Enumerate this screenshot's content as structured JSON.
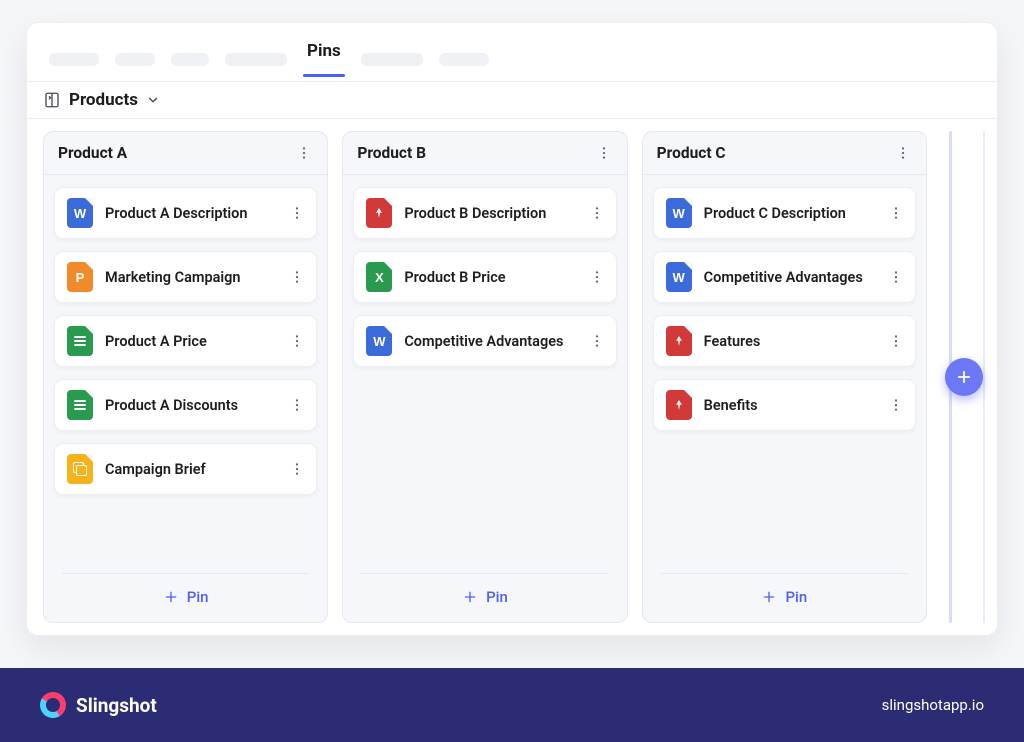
{
  "active_tab": "Pins",
  "section": {
    "title": "Products"
  },
  "columns": [
    {
      "title": "Product A",
      "pins": [
        {
          "label": "Product A Description",
          "type": "word"
        },
        {
          "label": "Marketing Campaign",
          "type": "ppt"
        },
        {
          "label": "Product A Price",
          "type": "sheet"
        },
        {
          "label": "Product A Discounts",
          "type": "sheet"
        },
        {
          "label": "Campaign Brief",
          "type": "doc"
        }
      ]
    },
    {
      "title": "Product B",
      "pins": [
        {
          "label": "Product B Description",
          "type": "pdf"
        },
        {
          "label": "Product B Price",
          "type": "excel"
        },
        {
          "label": "Competitive Advantages",
          "type": "word"
        }
      ]
    },
    {
      "title": "Product C",
      "pins": [
        {
          "label": "Product C Description",
          "type": "word"
        },
        {
          "label": "Competitive Advantages",
          "type": "word"
        },
        {
          "label": "Features",
          "type": "pdf"
        },
        {
          "label": "Benefits",
          "type": "pdf"
        }
      ]
    }
  ],
  "add_pin_label": "Pin",
  "footer": {
    "brand_name": "Slingshot",
    "url": "slingshotapp.io"
  }
}
